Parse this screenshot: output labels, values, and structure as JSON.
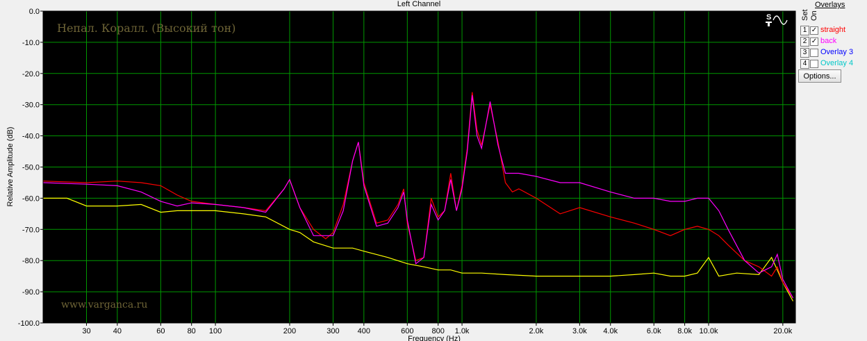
{
  "chart_data": {
    "type": "line",
    "title": "Left Channel",
    "xlabel": "Frequency (Hz)",
    "ylabel": "Relative Amplitude (dB)",
    "xscale": "log",
    "xlim": [
      20,
      22500
    ],
    "ylim": [
      -100,
      0
    ],
    "grid": true,
    "background": "#000000",
    "grid_color": "#009900",
    "annotation_title": "Непал. Коралл. (Высокий тон)",
    "annotation_footer": "www.varganca.ru",
    "yticks": [
      0,
      -10,
      -20,
      -30,
      -40,
      -50,
      -60,
      -70,
      -80,
      -90,
      -100
    ],
    "ytick_labels": [
      "0.0",
      "-10.0",
      "-20.0",
      "-30.0",
      "-40.0",
      "-50.0",
      "-60.0",
      "-70.0",
      "-80.0",
      "-90.0",
      "-100.0"
    ],
    "xticks": [
      30,
      40,
      60,
      80,
      100,
      200,
      300,
      400,
      600,
      800,
      1000,
      2000,
      3000,
      4000,
      6000,
      8000,
      10000,
      20000
    ],
    "xtick_labels": [
      "30",
      "40",
      "60",
      "80",
      "100",
      "200",
      "300",
      "400",
      "600",
      "800",
      "1.0k",
      "2.0k",
      "3.0k",
      "4.0k",
      "6.0k",
      "8.0k",
      "10.0k",
      "20.0k"
    ],
    "series": [
      {
        "name": "straight",
        "color": "#ff0000",
        "x": [
          20,
          30,
          40,
          50,
          60,
          70,
          80,
          100,
          130,
          160,
          190,
          200,
          220,
          250,
          280,
          300,
          330,
          360,
          380,
          400,
          450,
          500,
          550,
          580,
          600,
          650,
          700,
          750,
          800,
          850,
          900,
          950,
          1000,
          1050,
          1100,
          1150,
          1200,
          1300,
          1400,
          1500,
          1600,
          1700,
          2000,
          2500,
          3000,
          4000,
          5000,
          6000,
          7000,
          8000,
          9000,
          10000,
          11000,
          12000,
          14000,
          16000,
          18000,
          19000,
          20000,
          22000
        ],
        "y": [
          -54.5,
          -55,
          -54.5,
          -55,
          -56,
          -59,
          -61,
          -62,
          -63,
          -64,
          -57,
          -54,
          -63,
          -70,
          -73,
          -71,
          -62,
          -48,
          -42,
          -55,
          -68,
          -67,
          -62,
          -57,
          -68,
          -80,
          -79,
          -60,
          -66,
          -64,
          -52,
          -64,
          -56,
          -44,
          -26,
          -38,
          -43,
          -30,
          -42,
          -55,
          -58,
          -57,
          -60,
          -65,
          -63,
          -66,
          -68,
          -70,
          -72,
          -70,
          -69,
          -70,
          -72,
          -75,
          -80,
          -82,
          -85,
          -82,
          -87,
          -92
        ]
      },
      {
        "name": "back",
        "color": "#ff00ff",
        "x": [
          20,
          30,
          40,
          50,
          60,
          70,
          80,
          100,
          130,
          160,
          190,
          200,
          220,
          250,
          280,
          300,
          330,
          360,
          380,
          400,
          450,
          500,
          550,
          580,
          600,
          650,
          700,
          750,
          800,
          850,
          900,
          950,
          1000,
          1050,
          1100,
          1150,
          1200,
          1300,
          1400,
          1500,
          1600,
          1700,
          2000,
          2500,
          3000,
          4000,
          5000,
          6000,
          7000,
          8000,
          9000,
          10000,
          11000,
          12000,
          14000,
          16000,
          18000,
          19000,
          20000,
          22000
        ],
        "y": [
          -55,
          -55.5,
          -56,
          -58,
          -61,
          -62.5,
          -61.5,
          -62,
          -63,
          -64.5,
          -57,
          -54,
          -63,
          -72,
          -72,
          -72,
          -64,
          -48,
          -42,
          -56,
          -69,
          -68,
          -63,
          -58,
          -67,
          -81,
          -79,
          -62,
          -67,
          -64,
          -54,
          -64,
          -57,
          -45,
          -27,
          -40,
          -44,
          -29,
          -43,
          -52,
          -52,
          -52,
          -53,
          -55,
          -55,
          -58,
          -60,
          -60,
          -61,
          -61,
          -60,
          -60,
          -64,
          -70,
          -80,
          -84,
          -82,
          -78,
          -86,
          -92
        ]
      },
      {
        "name": "",
        "color": "#ffff00",
        "x": [
          20,
          25,
          30,
          40,
          50,
          60,
          70,
          80,
          100,
          130,
          160,
          200,
          220,
          250,
          300,
          330,
          360,
          400,
          500,
          600,
          700,
          800,
          900,
          1000,
          1200,
          1500,
          2000,
          3000,
          4000,
          5000,
          6000,
          7000,
          8000,
          9000,
          10000,
          11000,
          13000,
          16000,
          18000,
          19000,
          20000,
          22000
        ],
        "y": [
          -60,
          -60,
          -62.5,
          -62.5,
          -62,
          -64.5,
          -64,
          -64,
          -64,
          -65,
          -66,
          -70,
          -71,
          -74,
          -76,
          -76,
          -76,
          -77,
          -79,
          -81,
          -82,
          -83,
          -83,
          -84,
          -84,
          -84.5,
          -85,
          -85,
          -85,
          -84.5,
          -84,
          -85,
          -85,
          -84,
          -79,
          -85,
          -84,
          -84.5,
          -79,
          -83,
          -87,
          -93
        ]
      }
    ]
  },
  "sidebar": {
    "set_header": "Set",
    "on_header": "On",
    "overlays_header": "Overlays",
    "options_label": "Options...",
    "icon": "spectrum-sine-icon",
    "overlays": [
      {
        "num": "1",
        "checked": true,
        "check": "✓",
        "label": "straight",
        "color": "#ff0000"
      },
      {
        "num": "2",
        "checked": true,
        "check": "✓",
        "label": "back",
        "color": "#ff00ff"
      },
      {
        "num": "3",
        "checked": false,
        "check": "",
        "label": "Overlay 3",
        "color": "#0000ff"
      },
      {
        "num": "4",
        "checked": false,
        "check": "",
        "label": "Overlay 4",
        "color": "#00c8c8"
      }
    ]
  }
}
